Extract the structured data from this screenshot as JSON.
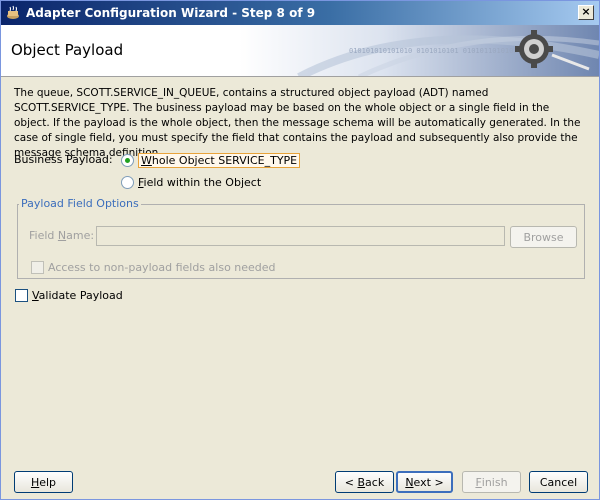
{
  "window": {
    "title": "Adapter Configuration Wizard - Step 8 of 9",
    "close_label": "×"
  },
  "header": {
    "title": "Object Payload",
    "graphic_text": "010101010101010 0101010101 0101011010100101010"
  },
  "description": "The queue, SCOTT.SERVICE_IN_QUEUE, contains a structured object payload (ADT) named SCOTT.SERVICE_TYPE. The business payload may be based on the whole object or a single field in the object. If the payload is the whole object, then the message schema will be automatically generated. In the case of single field, you must specify the field that contains the payload and subsequently also provide the message schema definition.",
  "business_payload": {
    "label": "Business Payload:",
    "options": [
      {
        "label_first": "W",
        "label_rest": "hole Object SERVICE_TYPE",
        "selected": true
      },
      {
        "label_first": "F",
        "label_rest": "ield within the Object",
        "selected": false
      }
    ]
  },
  "payload_field_options": {
    "legend": "Payload Field Options",
    "field_name_label_first": "Field ",
    "field_name_label_ul": "N",
    "field_name_label_rest": "ame:",
    "field_name_value": "",
    "browse_label": "Browse",
    "access_checkbox_label": "Access to non-payload fields also needed",
    "access_checked": false
  },
  "validate_payload": {
    "label_first": "V",
    "label_rest": "alidate Payload",
    "checked": false
  },
  "buttons": {
    "help_first": "H",
    "help_rest": "elp",
    "back_prefix": "< ",
    "back_first": "B",
    "back_rest": "ack",
    "next_first": "N",
    "next_rest": "ext >",
    "finish_first": "F",
    "finish_rest": "inish",
    "cancel": "Cancel"
  },
  "colors": {
    "title_bar": "#0a246a",
    "accent": "#3c6ebc",
    "radio_selected": "#21a121",
    "focus_outline": "#e8a33b"
  }
}
